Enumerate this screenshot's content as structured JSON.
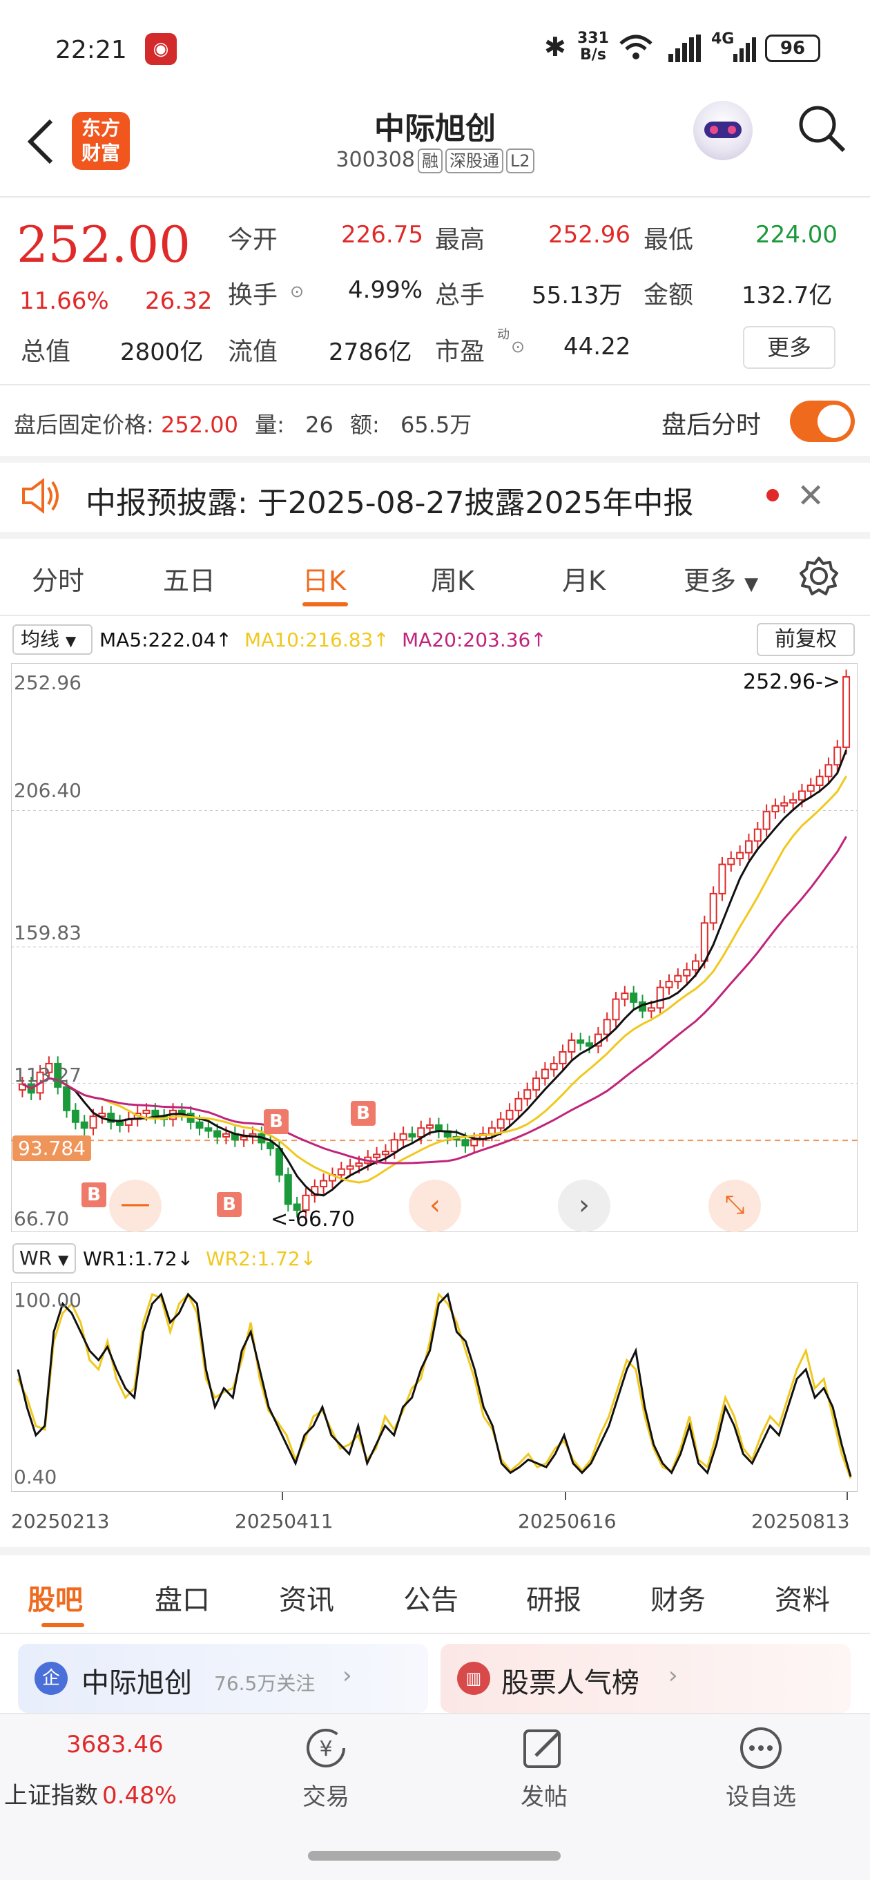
{
  "status_bar": {
    "time": "22:21",
    "net_speed_top": "331",
    "net_speed_bottom": "B/s",
    "network": "4G",
    "battery": "96"
  },
  "header": {
    "logo_line1": "东方",
    "logo_line2": "财富",
    "title": "中际旭创",
    "code": "300308",
    "tags": [
      "融",
      "深股通",
      "L2"
    ]
  },
  "quote": {
    "price": "252.00",
    "change_pct": "11.66%",
    "change": "26.32",
    "fields": [
      {
        "label": "今开",
        "value": "226.75",
        "color": "red"
      },
      {
        "label": "最高",
        "value": "252.96",
        "color": "red"
      },
      {
        "label": "最低",
        "value": "224.00",
        "color": "green"
      },
      {
        "label": "换手",
        "value": "4.99%",
        "color": "dark"
      },
      {
        "label": "总手",
        "value": "55.13万",
        "color": "dark"
      },
      {
        "label": "金额",
        "value": "132.7亿",
        "color": "dark"
      },
      {
        "label": "总值",
        "value": "2800亿",
        "color": "dark"
      },
      {
        "label": "流值",
        "value": "2786亿",
        "color": "dark"
      },
      {
        "label": "市盈",
        "value": "44.22",
        "color": "dark",
        "sup": "动"
      }
    ],
    "more_label": "更多"
  },
  "after_hours": {
    "label": "盘后固定价格:",
    "price": "252.00",
    "vol_label": "量:",
    "vol": "26",
    "amt_label": "额:",
    "amt": "65.5万",
    "toggle_label": "盘后分时",
    "toggle_on": true
  },
  "notice": {
    "text": "中报预披露: 于2025-08-27披露2025年中报"
  },
  "chart_tabs": {
    "items": [
      "分时",
      "五日",
      "日K",
      "周K",
      "月K",
      "更多"
    ],
    "active": 2
  },
  "ma_bar": {
    "selector": "均线",
    "ma5": "MA5:222.04",
    "ma10": "MA10:216.83",
    "ma20": "MA20:203.36",
    "adjust": "前复权"
  },
  "wr_bar": {
    "selector": "WR",
    "wr1": "WR1:1.72",
    "wr2": "WR2:1.72"
  },
  "colors": {
    "red": "#e02a2a",
    "green": "#1a9a3a",
    "ma5": "#111111",
    "ma10": "#f0c81e",
    "ma20": "#c0247a",
    "orange": "#f06a1e"
  },
  "chart_data": {
    "type": "candlestick",
    "price_axis": {
      "ticks": [
        "252.96",
        "206.40",
        "159.83",
        "113.27",
        "66.70"
      ],
      "ylim": [
        66.7,
        252.96
      ]
    },
    "current_line_label": "93.784",
    "max_label": "252.96->",
    "min_label": "<-66.70",
    "buy_markers": [
      "B",
      "B",
      "B",
      "B"
    ],
    "x_ticks": [
      "20250213",
      "20250411",
      "20250616",
      "20250813"
    ],
    "closes": [
      113,
      110,
      117,
      120,
      112,
      104,
      100,
      98,
      102,
      103,
      100,
      99,
      101,
      103,
      104,
      102,
      101,
      104,
      103,
      100,
      98,
      97,
      95,
      96,
      94,
      95,
      96,
      93,
      91,
      82,
      72,
      70,
      75,
      78,
      80,
      82,
      84,
      85,
      86,
      88,
      89,
      90,
      94,
      96,
      95,
      98,
      99,
      97,
      95,
      94,
      92,
      94,
      96,
      98,
      101,
      104,
      108,
      111,
      115,
      118,
      120,
      124,
      128,
      127,
      126,
      130,
      135,
      142,
      144,
      141,
      138,
      139,
      146,
      148,
      150,
      152,
      155,
      168,
      178,
      188,
      190,
      192,
      196,
      200,
      206,
      208,
      209,
      210,
      213,
      215,
      218,
      222,
      228,
      252
    ],
    "wr_axis": {
      "ticks": [
        "100.00",
        "0.40"
      ],
      "ylim": [
        0,
        100
      ]
    },
    "wr1": [
      60,
      40,
      25,
      30,
      80,
      95,
      90,
      80,
      70,
      65,
      72,
      60,
      50,
      45,
      80,
      95,
      100,
      85,
      90,
      100,
      95,
      60,
      40,
      50,
      45,
      70,
      80,
      60,
      40,
      30,
      20,
      10,
      25,
      30,
      40,
      25,
      20,
      15,
      30,
      10,
      20,
      30,
      25,
      40,
      45,
      60,
      70,
      95,
      100,
      80,
      75,
      60,
      40,
      30,
      10,
      5,
      8,
      12,
      10,
      8,
      15,
      25,
      10,
      5,
      10,
      20,
      30,
      45,
      60,
      70,
      40,
      20,
      10,
      5,
      15,
      30,
      10,
      5,
      20,
      40,
      30,
      15,
      10,
      20,
      30,
      25,
      40,
      55,
      60,
      45,
      50,
      40,
      20,
      3
    ],
    "wr2": [
      55,
      45,
      30,
      28,
      75,
      90,
      95,
      85,
      65,
      60,
      75,
      55,
      45,
      50,
      85,
      100,
      98,
      80,
      95,
      100,
      90,
      55,
      45,
      48,
      50,
      65,
      85,
      55,
      38,
      32,
      25,
      12,
      22,
      35,
      38,
      28,
      18,
      20,
      25,
      12,
      18,
      35,
      28,
      38,
      50,
      55,
      75,
      100,
      95,
      85,
      70,
      55,
      35,
      28,
      12,
      6,
      10,
      15,
      8,
      10,
      18,
      22,
      12,
      6,
      12,
      25,
      35,
      50,
      65,
      60,
      35,
      18,
      8,
      6,
      18,
      35,
      12,
      8,
      25,
      45,
      35,
      18,
      12,
      25,
      35,
      30,
      45,
      60,
      70,
      50,
      55,
      35,
      15,
      2
    ]
  },
  "subtabs": {
    "items": [
      "股吧",
      "盘口",
      "资讯",
      "公告",
      "研报",
      "财务",
      "资料"
    ],
    "active": 0
  },
  "cards": {
    "card1_title": "中际旭创",
    "card1_sub": "76.5万关注",
    "card2_title": "股票人气榜"
  },
  "bottom_bar": {
    "index_value": "3683.46",
    "index_name": "上证指数",
    "index_pct": "0.48%",
    "btn1": "交易",
    "btn2": "发帖",
    "btn3": "设自选"
  }
}
